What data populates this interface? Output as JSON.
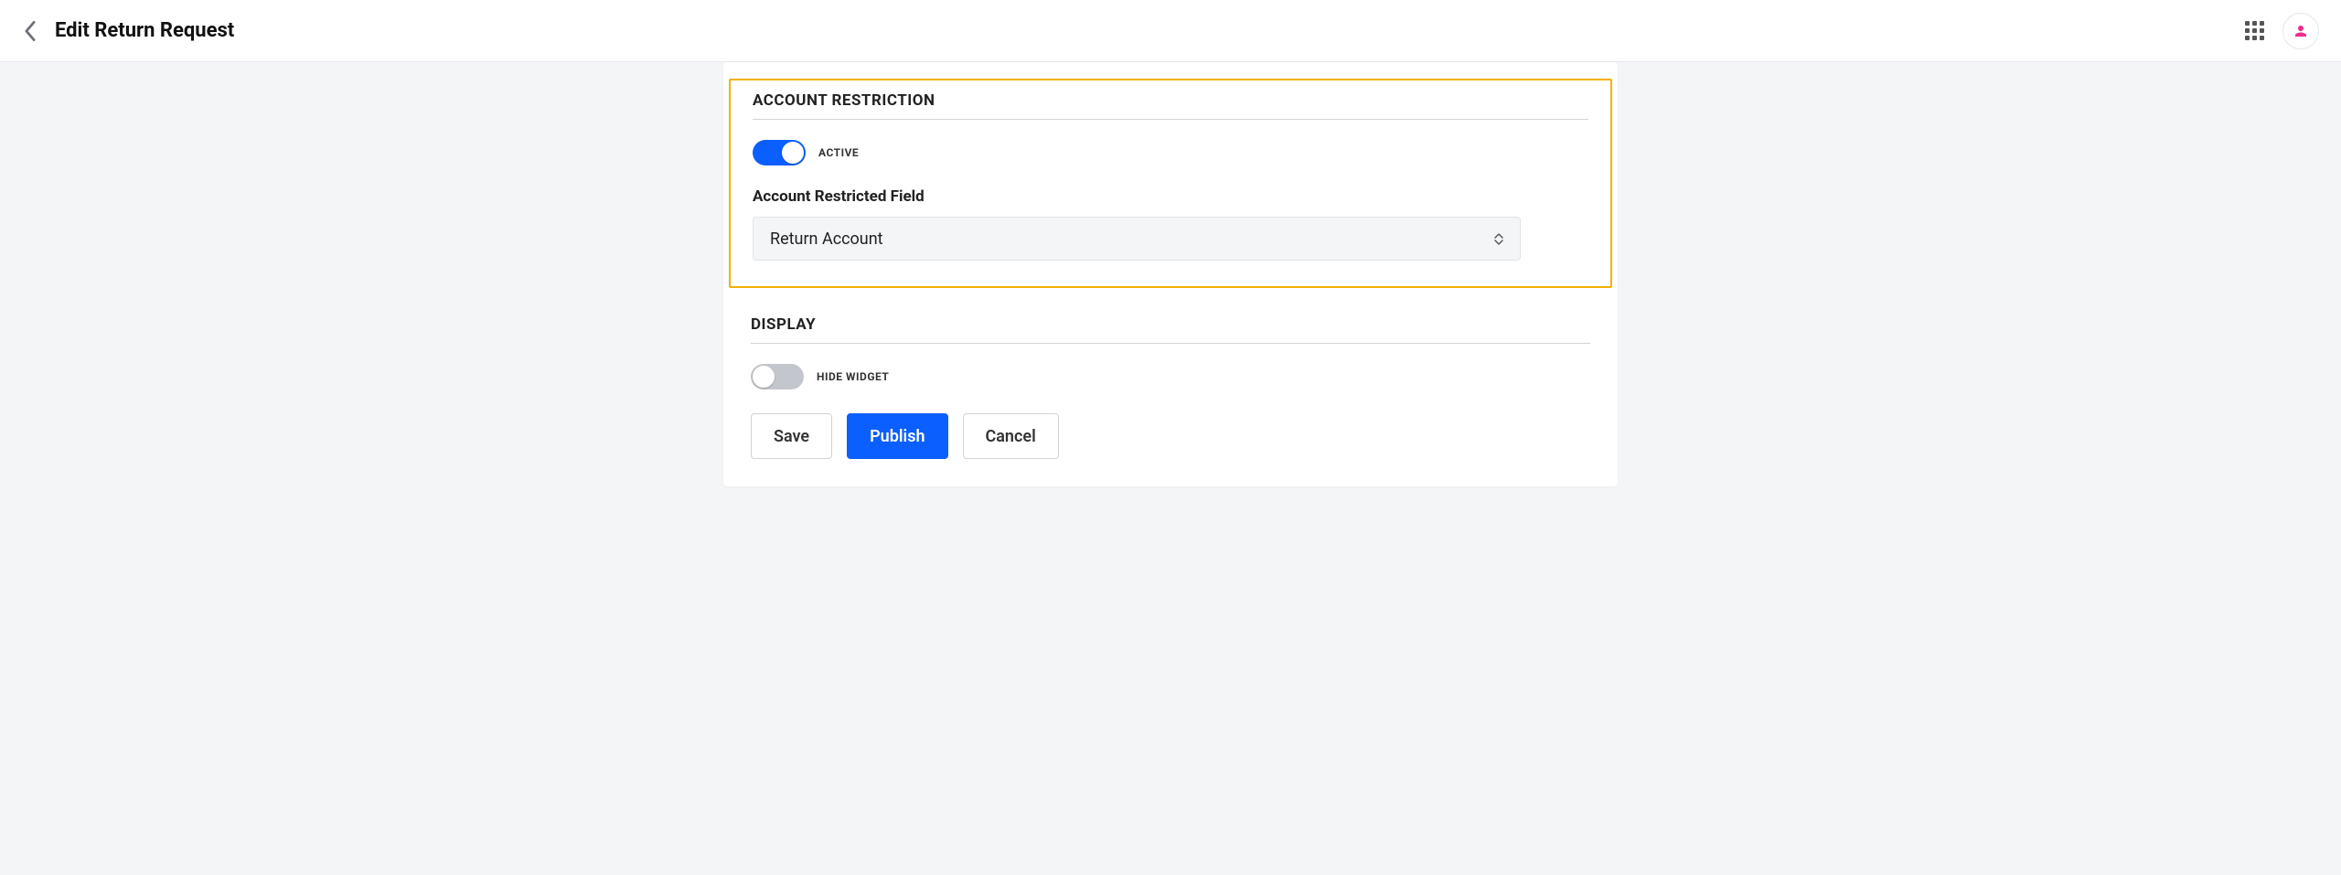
{
  "header": {
    "title": "Edit Return Request"
  },
  "accountRestriction": {
    "sectionTitle": "ACCOUNT RESTRICTION",
    "toggleLabel": "ACTIVE",
    "fieldLabel": "Account Restricted Field",
    "selectedValue": "Return Account"
  },
  "display": {
    "sectionTitle": "DISPLAY",
    "toggleLabel": "HIDE WIDGET"
  },
  "buttons": {
    "save": "Save",
    "publish": "Publish",
    "cancel": "Cancel"
  }
}
